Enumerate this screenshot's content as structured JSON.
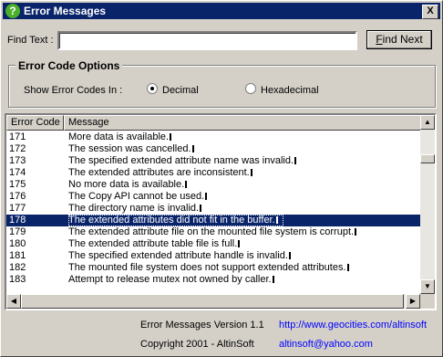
{
  "window": {
    "title": "Error Messages",
    "icon": "question-icon",
    "close_label": "X"
  },
  "find": {
    "label": "Find Text :",
    "value": "",
    "button_label_accel": "F",
    "button_label_rest": "ind Next"
  },
  "options": {
    "group_title": "Error Code Options",
    "show_label": "Show Error Codes In :",
    "radio_decimal": "Decimal",
    "radio_hex": "Hexadecimal",
    "selected": "Decimal"
  },
  "list": {
    "columns": [
      "Error Code",
      "Message"
    ],
    "selected_code": "178",
    "rows": [
      {
        "code": "171",
        "message": "More data is available."
      },
      {
        "code": "172",
        "message": "The session was cancelled."
      },
      {
        "code": "173",
        "message": "The specified extended attribute name was invalid."
      },
      {
        "code": "174",
        "message": "The extended attributes are inconsistent."
      },
      {
        "code": "175",
        "message": "No more data is available."
      },
      {
        "code": "176",
        "message": "The Copy API cannot be used."
      },
      {
        "code": "177",
        "message": "The directory name is invalid."
      },
      {
        "code": "178",
        "message": "The extended attributes did not fit in the buffer."
      },
      {
        "code": "179",
        "message": "The extended attribute file on the mounted file system is corrupt."
      },
      {
        "code": "180",
        "message": "The extended attribute table file is full."
      },
      {
        "code": "181",
        "message": "The specified extended attribute handle is invalid."
      },
      {
        "code": "182",
        "message": "The mounted file system does not support extended attributes."
      },
      {
        "code": "183",
        "message": "Attempt to release mutex not owned by caller."
      }
    ]
  },
  "footer": {
    "version": "Error Messages Version 1.1",
    "copyright": "Copyright 2001 - AltinSoft",
    "url": "http://www.geocities.com/altinsoft",
    "email": "altinsoft@yahoo.com"
  },
  "colors": {
    "selection": "#0a246a",
    "link": "#0000ff",
    "face": "#d4d0c8"
  }
}
